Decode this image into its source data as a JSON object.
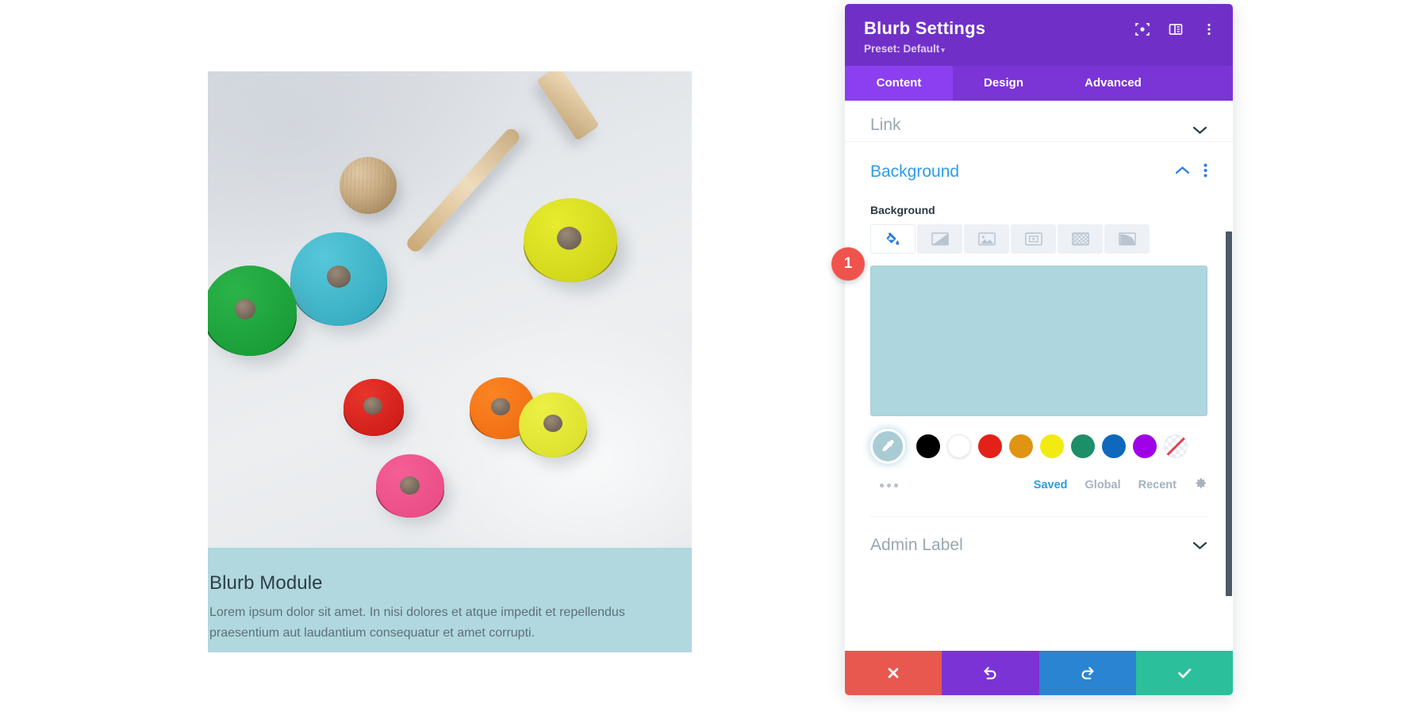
{
  "preview": {
    "blurb": {
      "title": "Blurb Module",
      "text": "Lorem ipsum dolor sit amet. In nisi dolores et atque impedit et repellendus praesentium aut laudantium consequatur et amet corrupti.",
      "background_color": "#b0d8de",
      "photo_alt": "wooden-stacking-toy-photo"
    }
  },
  "panel": {
    "title": "Blurb Settings",
    "preset_label": "Preset: Default",
    "preset_caret": "▾",
    "header_icons": [
      {
        "name": "focus-icon"
      },
      {
        "name": "layout-columns-icon"
      },
      {
        "name": "kebab-menu-icon"
      }
    ],
    "tabs": [
      {
        "label": "Content",
        "active": true
      },
      {
        "label": "Design",
        "active": false
      },
      {
        "label": "Advanced",
        "active": false
      }
    ],
    "sections": {
      "link": {
        "label": "Link",
        "expanded": false
      },
      "background": {
        "label": "Background",
        "expanded": true,
        "field_label": "Background",
        "types": [
          {
            "name": "background-color",
            "active": true
          },
          {
            "name": "background-gradient",
            "active": false
          },
          {
            "name": "background-image",
            "active": false
          },
          {
            "name": "background-video",
            "active": false
          },
          {
            "name": "background-pattern",
            "active": false
          },
          {
            "name": "background-mask",
            "active": false
          }
        ],
        "selected_color": "#aed6de",
        "eyedropper": {
          "name": "eyedropper-tool",
          "color": "#a9ccd4"
        },
        "swatches": [
          {
            "name": "swatch-black",
            "color": "#000000"
          },
          {
            "name": "swatch-white",
            "color": "#ffffff"
          },
          {
            "name": "swatch-red",
            "color": "#e32119"
          },
          {
            "name": "swatch-orange",
            "color": "#e09414"
          },
          {
            "name": "swatch-yellow",
            "color": "#f2eb12"
          },
          {
            "name": "swatch-green",
            "color": "#1c8f68"
          },
          {
            "name": "swatch-blue",
            "color": "#0f68bc"
          },
          {
            "name": "swatch-purple",
            "color": "#a002e8"
          },
          {
            "name": "swatch-transparent",
            "color": "transparent"
          }
        ],
        "palette_tabs": [
          {
            "label": "Saved",
            "active": true
          },
          {
            "label": "Global",
            "active": false
          },
          {
            "label": "Recent",
            "active": false
          }
        ],
        "more_dots": "more-options",
        "settings_gear": "gear-icon"
      },
      "admin": {
        "label": "Admin Label",
        "expanded": false
      }
    },
    "footer_buttons": [
      {
        "name": "discard-changes",
        "glyph": "✖",
        "color": "#e9584f"
      },
      {
        "name": "undo",
        "glyph": "↺",
        "color": "#7c33d6"
      },
      {
        "name": "redo",
        "glyph": "↻",
        "color": "#2a84d2"
      },
      {
        "name": "save-changes",
        "glyph": "✔",
        "color": "#2bbf9b"
      }
    ]
  },
  "annotation": {
    "step_number": "1"
  }
}
